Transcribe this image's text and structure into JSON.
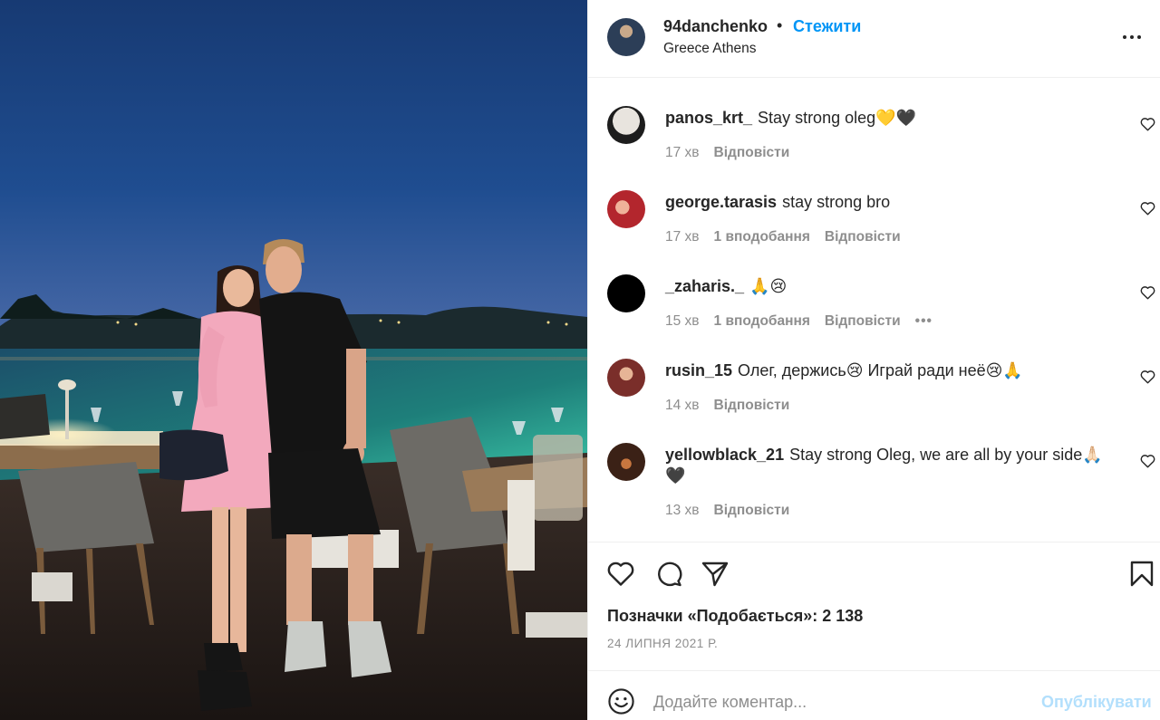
{
  "post": {
    "author": "94danchenko",
    "separator": "•",
    "follow_label": "Стежити",
    "location": "Greece Athens",
    "more_icon": "more-horizontal-icon",
    "photo_alt": "Couple standing on a seaside restaurant terrace at dusk"
  },
  "comments": [
    {
      "user": "panos_krt_",
      "text": "Stay strong oleg💛🖤",
      "time": "17 хв",
      "likes": "",
      "reply": "Відповісти",
      "avatar_color": "#2b2b2b"
    },
    {
      "user": "george.tarasis",
      "text": "stay strong bro",
      "time": "17 хв",
      "likes": "1 вподобання",
      "reply": "Відповісти",
      "avatar_color": "#b3262d"
    },
    {
      "user": "_zaharis._",
      "text": "🙏😢",
      "time": "15 хв",
      "likes": "1 вподобання",
      "reply": "Відповісти",
      "more": "•••",
      "avatar_color": "#000000"
    },
    {
      "user": "rusin_15",
      "text": "Олег, держись😢 Играй ради неё😢🙏",
      "time": "14 хв",
      "likes": "",
      "reply": "Відповісти",
      "avatar_color": "#7a2e2a"
    },
    {
      "user": "yellowblack_21",
      "text": "Stay strong Oleg, we are all by your side🙏🏻🖤",
      "time": "13 хв",
      "likes": "",
      "reply": "Відповісти",
      "avatar_color": "#4a2a1c"
    }
  ],
  "actions": {
    "like_icon": "heart-icon",
    "comment_icon": "comment-bubble-icon",
    "share_icon": "paper-plane-icon",
    "save_icon": "bookmark-icon",
    "likes_text": "Позначки «Подобається»: 2 138",
    "date": "24 ЛИПНЯ 2021 Р."
  },
  "add_comment": {
    "emoji_icon": "smiley-icon",
    "placeholder": "Додайте коментар...",
    "publish_label": "Опублікувати"
  },
  "colors": {
    "accent": "#0095f6",
    "publish_disabled": "#b2dffc",
    "muted": "#8e8e8e",
    "text": "#262626"
  }
}
